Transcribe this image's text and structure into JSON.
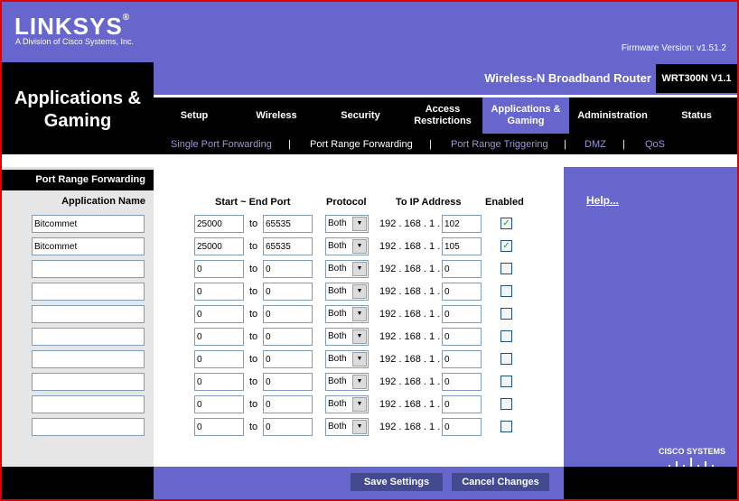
{
  "brand": {
    "logo": "LINKSYS",
    "logo_reg": "®",
    "tagline": "A Division of Cisco Systems, Inc.",
    "firmware": "Firmware Version: v1.51.2"
  },
  "header": {
    "page_title_line1": "Applications &",
    "page_title_line2": "Gaming",
    "product_name": "Wireless-N Broadband Router",
    "model": "WRT300N V1.1"
  },
  "tabs": [
    {
      "label": "Setup"
    },
    {
      "label": "Wireless"
    },
    {
      "label": "Security"
    },
    {
      "label": "Access Restrictions"
    },
    {
      "label": "Applications & Gaming",
      "active": true
    },
    {
      "label": "Administration"
    },
    {
      "label": "Status"
    }
  ],
  "subtabs": [
    {
      "label": "Single Port Forwarding"
    },
    {
      "label": "Port Range Forwarding",
      "active": true
    },
    {
      "label": "Port Range Triggering"
    },
    {
      "label": "DMZ"
    },
    {
      "label": "QoS"
    }
  ],
  "subtab_separator": "|",
  "section": {
    "title": "Port Range Forwarding",
    "app_name_header": "Application Name"
  },
  "columns": {
    "port": "Start ~ End Port",
    "protocol": "Protocol",
    "ip": "To IP Address",
    "enabled": "Enabled"
  },
  "to_label": "to",
  "ip_prefix": "192 . 168 . 1 .",
  "rows": [
    {
      "app": "Bitcommet",
      "start": "25000",
      "end": "65535",
      "protocol": "Both",
      "ip": "102",
      "enabled": true
    },
    {
      "app": "Bitcommet",
      "start": "25000",
      "end": "65535",
      "protocol": "Both",
      "ip": "105",
      "enabled": true
    },
    {
      "app": "",
      "start": "0",
      "end": "0",
      "protocol": "Both",
      "ip": "0",
      "enabled": false
    },
    {
      "app": "",
      "start": "0",
      "end": "0",
      "protocol": "Both",
      "ip": "0",
      "enabled": false
    },
    {
      "app": "",
      "start": "0",
      "end": "0",
      "protocol": "Both",
      "ip": "0",
      "enabled": false
    },
    {
      "app": "",
      "start": "0",
      "end": "0",
      "protocol": "Both",
      "ip": "0",
      "enabled": false
    },
    {
      "app": "",
      "start": "0",
      "end": "0",
      "protocol": "Both",
      "ip": "0",
      "enabled": false
    },
    {
      "app": "",
      "start": "0",
      "end": "0",
      "protocol": "Both",
      "ip": "0",
      "enabled": false
    },
    {
      "app": "",
      "start": "0",
      "end": "0",
      "protocol": "Both",
      "ip": "0",
      "enabled": false
    },
    {
      "app": "",
      "start": "0",
      "end": "0",
      "protocol": "Both",
      "ip": "0",
      "enabled": false
    }
  ],
  "help": "Help...",
  "cisco": "CISCO SYSTEMS",
  "buttons": {
    "save": "Save Settings",
    "cancel": "Cancel Changes"
  },
  "colors": {
    "accent": "#6666cc",
    "border": "#e00000"
  }
}
